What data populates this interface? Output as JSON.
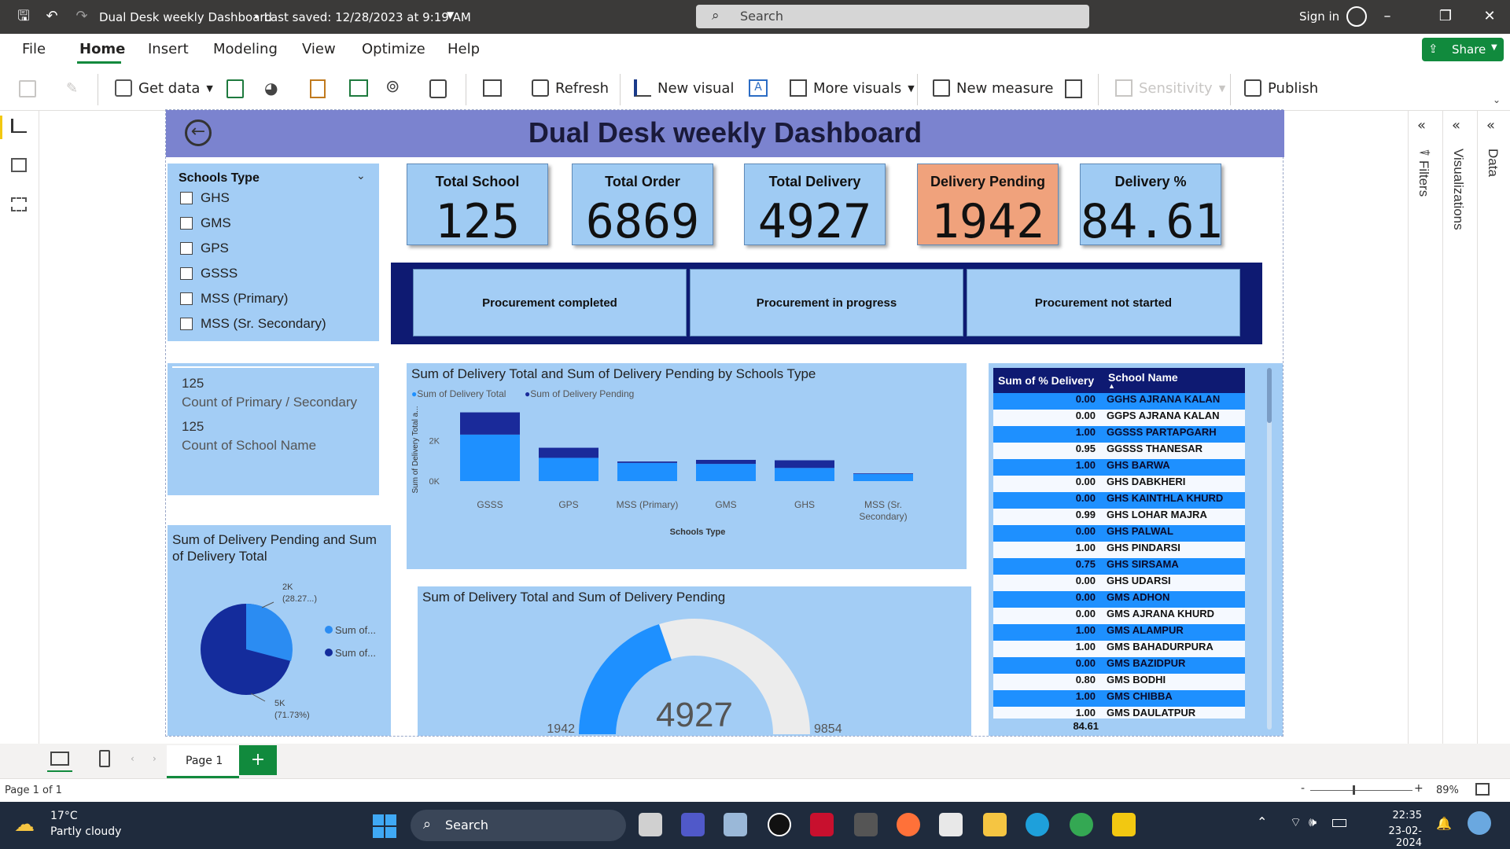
{
  "titlebar": {
    "title": "Dual Desk weekly Dashboard",
    "saved": "• Last saved: 12/28/2023 at 9:19 AM",
    "search_placeholder": "Search",
    "signin": "Sign in"
  },
  "menu": [
    "File",
    "Home",
    "Insert",
    "Modeling",
    "View",
    "Optimize",
    "Help"
  ],
  "share": "Share",
  "ribbon": {
    "get_data": "Get data",
    "refresh": "Refresh",
    "new_visual": "New visual",
    "more_visuals": "More visuals",
    "new_measure": "New measure",
    "sensitivity": "Sensitivity",
    "publish": "Publish"
  },
  "report": {
    "header_title": "Dual Desk weekly Dashboard",
    "slicer": {
      "title": "Schools Type",
      "options": [
        "GHS",
        "GMS",
        "GPS",
        "GSSS",
        "MSS (Primary)",
        "MSS (Sr. Secondary)"
      ]
    },
    "kpis": [
      {
        "label": "Total School",
        "value": "125"
      },
      {
        "label": "Total Order",
        "value": "6869"
      },
      {
        "label": "Total Delivery",
        "value": "4927"
      },
      {
        "label": "Delivery Pending",
        "value": "1942"
      },
      {
        "label": "Delivery %",
        "value": "84.61"
      }
    ],
    "procurement": [
      "Procurement completed",
      "Procurement in progress",
      "Procurement not started"
    ],
    "counts": [
      {
        "value": "125",
        "label": "Count of Primary / Secondary"
      },
      {
        "value": "125",
        "label": "Count of School Name"
      }
    ],
    "pie": {
      "title": "Sum of Delivery Pending and Sum of Delivery Total",
      "label_top": "2K",
      "label_top_pct": "(28.27...)",
      "label_bottom": "5K",
      "label_bottom_pct": "(71.73%)",
      "legend1": "Sum of...",
      "legend2": "Sum of..."
    },
    "gauge": {
      "title": "Sum of Delivery Total and Sum of Delivery Pending",
      "value": "4927",
      "min": "1942",
      "max": "9854"
    },
    "table": {
      "col1": "Sum of % Delivery",
      "col2": "School Name",
      "total": "84.61",
      "rows": [
        [
          "0.00",
          "GGHS AJRANA KALAN"
        ],
        [
          "0.00",
          "GGPS AJRANA KALAN"
        ],
        [
          "1.00",
          "GGSSS PARTAPGARH"
        ],
        [
          "0.95",
          "GGSSS THANESAR"
        ],
        [
          "1.00",
          "GHS BARWA"
        ],
        [
          "0.00",
          "GHS DABKHERI"
        ],
        [
          "0.00",
          "GHS KAINTHLA KHURD"
        ],
        [
          "0.99",
          "GHS LOHAR MAJRA"
        ],
        [
          "0.00",
          "GHS PALWAL"
        ],
        [
          "1.00",
          "GHS PINDARSI"
        ],
        [
          "0.75",
          "GHS SIRSAMA"
        ],
        [
          "0.00",
          "GHS UDARSI"
        ],
        [
          "0.00",
          "GMS ADHON"
        ],
        [
          "0.00",
          "GMS AJRANA KHURD"
        ],
        [
          "1.00",
          "GMS ALAMPUR"
        ],
        [
          "1.00",
          "GMS BAHADURPURA"
        ],
        [
          "0.00",
          "GMS BAZIDPUR"
        ],
        [
          "0.80",
          "GMS BODHI"
        ],
        [
          "1.00",
          "GMS CHIBBA"
        ],
        [
          "1.00",
          "GMS DAULATPUR"
        ]
      ]
    }
  },
  "chart_data": {
    "type": "bar",
    "title": "Sum of Delivery Total and Sum of Delivery Pending by Schools Type",
    "xlabel": "Schools Type",
    "ylabel": "Sum of Delivery Total a...",
    "categories": [
      "GSSS",
      "GPS",
      "MSS (Primary)",
      "GMS",
      "GHS",
      "MSS (Sr. Secondary)"
    ],
    "stacked": true,
    "ylim": [
      0,
      3500
    ],
    "yticks": [
      "0K",
      "2K"
    ],
    "series": [
      {
        "name": "Sum of Delivery Total",
        "values": [
          2300,
          1150,
          900,
          850,
          650,
          350
        ],
        "color": "#1e90ff"
      },
      {
        "name": "Sum of Delivery Pending",
        "values": [
          1100,
          500,
          70,
          200,
          380,
          30
        ],
        "color": "#1a2a9a"
      }
    ]
  },
  "pages": {
    "tab": "Page 1",
    "status": "Page 1 of 1",
    "zoom": "89%"
  },
  "taskbar": {
    "temp": "17°C",
    "weather": "Partly cloudy",
    "search": "Search",
    "time": "22:35",
    "date": "23-02-2024"
  },
  "panes": [
    "Filters",
    "Visualizations",
    "Data"
  ]
}
